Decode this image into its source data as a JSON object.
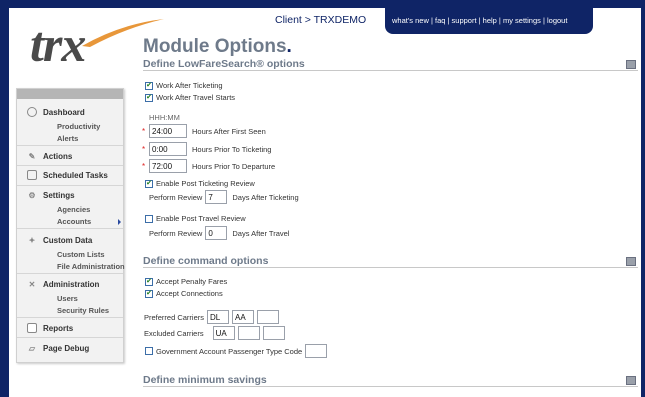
{
  "header": {
    "client_label": "Client > TRXDEMO",
    "nav_links": "what's new | faq | support | help | my settings | logout"
  },
  "logo": {
    "text": "trx"
  },
  "page_title": {
    "text": "Module Options",
    "dot": "."
  },
  "sidebar": {
    "items": [
      {
        "label": "Dashboard",
        "icon": "dashboard-icon",
        "sub": [
          "Productivity",
          "Alerts"
        ]
      },
      {
        "label": "Actions",
        "icon": "actions-icon",
        "sub": []
      },
      {
        "label": "Scheduled Tasks",
        "icon": "scheduled-tasks-icon",
        "sub": []
      },
      {
        "label": "Settings",
        "icon": "settings-icon",
        "sub": [
          "Agencies",
          "Accounts"
        ]
      },
      {
        "label": "Custom Data",
        "icon": "custom-data-icon",
        "sub": [
          "Custom Lists",
          "File Administration"
        ]
      },
      {
        "label": "Administration",
        "icon": "administration-icon",
        "sub": [
          "Users",
          "Security Rules"
        ]
      },
      {
        "label": "Reports",
        "icon": "reports-icon",
        "sub": []
      },
      {
        "label": "Page Debug",
        "icon": "page-debug-icon",
        "sub": []
      }
    ]
  },
  "lowfare": {
    "title": "Define LowFareSearch® options",
    "work_after_ticketing": {
      "label": "Work After Ticketing",
      "checked": true
    },
    "work_after_travel": {
      "label": "Work After Travel Starts",
      "checked": true
    },
    "time_format": "HHH:MM",
    "hours_after_first_seen": {
      "value": "24:00",
      "label": "Hours After First Seen"
    },
    "hours_prior_ticketing": {
      "value": "0:00",
      "label": "Hours Prior To Ticketing"
    },
    "hours_prior_departure": {
      "value": "72:00",
      "label": "Hours Prior To Departure"
    },
    "post_ticketing_review": {
      "label": "Enable Post Ticketing Review",
      "checked": true
    },
    "perform_review_ticketing": {
      "prefix": "Perform Review",
      "value": "7",
      "suffix": "Days After Ticketing"
    },
    "post_travel_review": {
      "label": "Enable Post Travel Review",
      "checked": false
    },
    "perform_review_travel": {
      "prefix": "Perform Review",
      "value": "0",
      "suffix": "Days After Travel"
    }
  },
  "command": {
    "title": "Define command options",
    "accept_penalty_fares": {
      "label": "Accept Penalty Fares",
      "checked": true
    },
    "accept_connections": {
      "label": "Accept Connections",
      "checked": true
    },
    "preferred_carriers": {
      "label": "Preferred Carriers",
      "values": [
        "DL",
        "AA",
        ""
      ]
    },
    "excluded_carriers": {
      "label": "Excluded Carriers",
      "values": [
        "UA",
        "",
        ""
      ]
    },
    "gov_ptc": {
      "label": "Government Account Passenger Type Code",
      "checked": false,
      "value": ""
    }
  },
  "savings": {
    "title": "Define minimum savings"
  },
  "required_marker": "*",
  "checkmark": "✔",
  "help_icon": "help-icon"
}
